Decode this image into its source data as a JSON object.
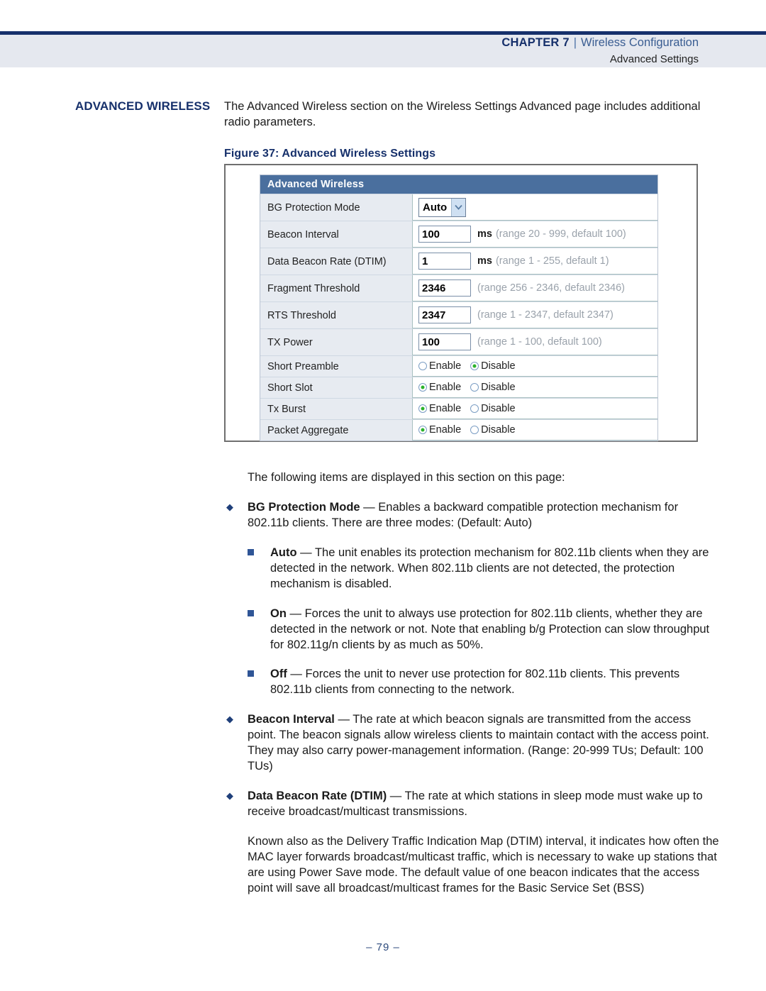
{
  "header": {
    "chapter_label": "CHAPTER 7",
    "separator": "|",
    "chapter_name": "Wireless Configuration",
    "subtitle": "Advanced Settings"
  },
  "side_heading": "ADVANCED WIRELESS",
  "intro_paragraph": "The Advanced Wireless section on the Wireless Settings Advanced page includes additional radio parameters.",
  "figure_caption": "Figure 37:  Advanced Wireless Settings",
  "figure": {
    "panel_title": "Advanced Wireless",
    "rows": [
      {
        "label": "BG Protection Mode",
        "type": "select",
        "value": "Auto",
        "unit": "",
        "hint": ""
      },
      {
        "label": "Beacon Interval",
        "type": "text",
        "value": "100",
        "unit": "ms",
        "hint": "(range 20 - 999, default 100)"
      },
      {
        "label": "Data Beacon Rate (DTIM)",
        "type": "text",
        "value": "1",
        "unit": "ms",
        "hint": "(range 1 - 255, default 1)"
      },
      {
        "label": "Fragment Threshold",
        "type": "text",
        "value": "2346",
        "unit": "",
        "hint": "(range 256 - 2346, default 2346)"
      },
      {
        "label": "RTS Threshold",
        "type": "text",
        "value": "2347",
        "unit": "",
        "hint": "(range 1 - 2347, default 2347)"
      },
      {
        "label": "TX Power",
        "type": "text",
        "value": "100",
        "unit": "",
        "hint": "(range 1 - 100, default 100)"
      },
      {
        "label": "Short Preamble",
        "type": "radio",
        "enable_label": "Enable",
        "disable_label": "Disable",
        "selected": "Disable"
      },
      {
        "label": "Short Slot",
        "type": "radio",
        "enable_label": "Enable",
        "disable_label": "Disable",
        "selected": "Enable"
      },
      {
        "label": "Tx Burst",
        "type": "radio",
        "enable_label": "Enable",
        "disable_label": "Disable",
        "selected": "Enable"
      },
      {
        "label": "Packet Aggregate",
        "type": "radio",
        "enable_label": "Enable",
        "disable_label": "Disable",
        "selected": "Enable"
      }
    ],
    "select_arrow_color": "#cfe0f2",
    "title_bar_color": "#4a6f9e",
    "radio_on_color": "#2bb32b"
  },
  "body": {
    "lead_in": "The following items are displayed in this section on this page:",
    "items": [
      {
        "level": 1,
        "term": "BG Protection Mode",
        "dash": " — ",
        "text": "Enables a backward compatible protection mechanism for 802.11b clients. There are three modes: (Default: Auto)"
      },
      {
        "level": 2,
        "term": "Auto",
        "dash": " — ",
        "text": "The unit enables its protection mechanism for 802.11b clients when they are detected in the network. When 802.11b clients are not detected, the protection mechanism is disabled."
      },
      {
        "level": 2,
        "term": "On",
        "dash": " — ",
        "text": "Forces the unit to always use protection for 802.11b clients, whether they are detected in the network or not. Note that enabling b/g Protection can slow throughput for 802.11g/n clients by as much as 50%."
      },
      {
        "level": 2,
        "term": "Off",
        "dash": " — ",
        "text": "Forces the unit to never use protection for 802.11b clients. This prevents 802.11b clients from connecting to the network."
      },
      {
        "level": 1,
        "term": "Beacon Interval",
        "dash": " — ",
        "text": "The rate at which beacon signals are transmitted from the access point. The beacon signals allow wireless clients to maintain contact with the access point. They may also carry power-management information. (Range: 20-999 TUs; Default: 100 TUs)"
      },
      {
        "level": 1,
        "term": "Data Beacon Rate (DTIM)",
        "dash": " — ",
        "text": "The rate at which stations in sleep mode must wake up to receive broadcast/multicast transmissions."
      }
    ],
    "closing_paragraph": "Known also as the Delivery Traffic Indication Map (DTIM) interval, it indicates how often the MAC layer forwards broadcast/multicast traffic, which is necessary to wake up stations that are using Power Save mode. The default value of one beacon indicates that the access point will save all broadcast/multicast frames for the Basic Service Set (BSS)"
  },
  "footer": {
    "page_number": "–  79  –"
  }
}
